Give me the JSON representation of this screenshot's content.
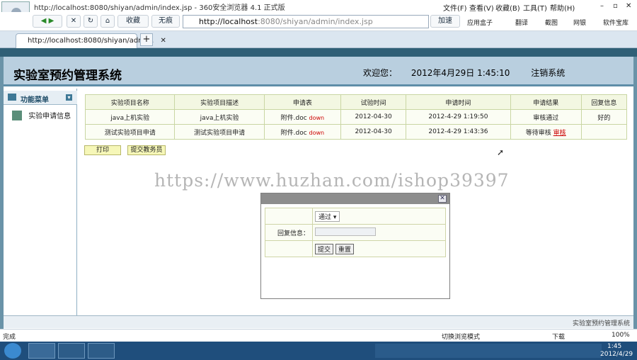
{
  "browser": {
    "title": "http://localhost:8080/shiyan/admin/index.jsp - 360安全浏览器 4.1 正式版",
    "menu": [
      "文件(F)",
      "查看(V)",
      "收藏(B)",
      "工具(T)",
      "帮助(H)"
    ],
    "toolbar": {
      "bookmark": "收藏",
      "no_trace": "无痕",
      "accelerate": "加速"
    },
    "address": {
      "host": "http://localhost",
      "path": ":8080/shiyan/admin/index.jsp"
    },
    "right_tools": [
      "应用盒子",
      "翻译",
      "截图",
      "网银",
      "软件宝库"
    ],
    "tab_label": "http://localhost:8080/shiyan/admi..."
  },
  "app": {
    "title": "实验室预约管理系统",
    "welcome_label": "欢迎您：",
    "datetime": "2012年4月29日  1:45:10",
    "logout": "注销系统",
    "menu_title": "功能菜单",
    "menu_items": [
      "实验申请信息"
    ],
    "footer_text": "实验室预约管理系统"
  },
  "table": {
    "columns": [
      "实验项目名称",
      "实验项目描述",
      "申请表",
      "试验时间",
      "申请时间",
      "申请结果",
      "回复信息"
    ],
    "rows": [
      {
        "name": "java上机实验",
        "desc": "java上机实验",
        "file": "附件.doc",
        "down": "down",
        "test_date": "2012-04-30",
        "apply_time": "2012-4-29 1:19:50",
        "result": "审核通过",
        "action": "",
        "reply": "好的"
      },
      {
        "name": "测试实验项目申请",
        "desc": "测试实验项目申请",
        "file": "附件.doc",
        "down": "down",
        "test_date": "2012-04-30",
        "apply_time": "2012-4-29 1:43:36",
        "result": "等待审核",
        "action": "审核",
        "reply": ""
      }
    ]
  },
  "buttons": {
    "print": "打印",
    "submit_to_admin": "提交教务员"
  },
  "watermark": "https://www.huzhan.com/ishop39397",
  "dialog": {
    "select_value": "通过",
    "reply_label": "回复信息：",
    "submit": "提交",
    "reset": "重置"
  },
  "status": {
    "left": "完成",
    "mode": "切换浏览模式",
    "download": "下载",
    "zoom": "100%"
  },
  "taskbar": {
    "time": "1:45",
    "date": "2012/4/29"
  }
}
